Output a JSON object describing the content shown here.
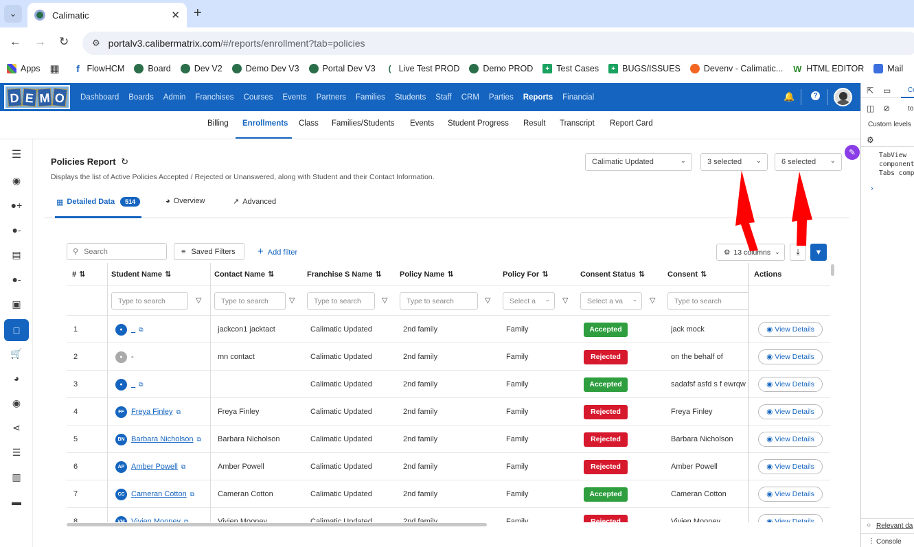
{
  "browser": {
    "tab_title": "Calimatic",
    "url_domain": "portalv3.calibermatrix.com",
    "url_path": "/#/reports/enrollment?tab=policies",
    "bookmarks": [
      "Apps",
      "FlowHCM",
      "Board",
      "Dev V2",
      "Demo Dev V3",
      "Portal Dev V3",
      "Live Test PROD",
      "Demo PROD",
      "Test Cases",
      "BUGS/ISSUES",
      "Devenv - Calimatic...",
      "HTML EDITOR",
      "Mail"
    ]
  },
  "app": {
    "logo_letters": [
      "D",
      "E",
      "M",
      "O"
    ],
    "main_menu": [
      "Dashboard",
      "Boards",
      "Admin",
      "Franchises",
      "Courses",
      "Events",
      "Partners",
      "Families",
      "Students",
      "Staff",
      "CRM",
      "Parties",
      "Reports",
      "Financial"
    ],
    "main_menu_active": "Reports",
    "sub_menu": [
      "Billing",
      "Enrollments",
      "Class",
      "Families/Students",
      "Events",
      "Student Progress",
      "Result",
      "Transcript",
      "Report Card"
    ],
    "sub_menu_active": "Enrollments"
  },
  "report": {
    "title": "Policies Report",
    "subtitle": "Displays the list of Active Policies Accepted / Rejected or Unanswered, along with Student and their Contact Information.",
    "franchise_select": "Calimatic Updated",
    "select2": "3 selected",
    "select3": "6 selected",
    "tabs": [
      "Detailed Data",
      "Overview",
      "Advanced"
    ],
    "detailed_count": "514",
    "search_placeholder": "Search",
    "saved_filters": "Saved Filters",
    "add_filter": "Add filter",
    "columns_button": "13 columns"
  },
  "table": {
    "headers": [
      "#",
      "Student Name",
      "Contact Name",
      "Franchise S Name",
      "Policy Name",
      "Policy For",
      "Consent Status",
      "Consent",
      "Actions"
    ],
    "filter_placeholders": {
      "type": "Type to search",
      "select_a": "Select a",
      "select_a_va": "Select a va"
    },
    "rows": [
      {
        "num": "1",
        "initials": "",
        "student": "_",
        "contact": "jackcon1 jacktact",
        "franchise": "Calimatic Updated",
        "policy": "2nd family",
        "for": "Family",
        "status": "Accepted",
        "consent": "jack mock",
        "action": "View Details"
      },
      {
        "num": "2",
        "initials": "",
        "student": "-",
        "contact": "mn contact",
        "franchise": "Calimatic Updated",
        "policy": "2nd family",
        "for": "Family",
        "status": "Rejected",
        "consent": "on the behalf of",
        "action": "View Details"
      },
      {
        "num": "3",
        "initials": "",
        "student": "_",
        "contact": "",
        "franchise": "Calimatic Updated",
        "policy": "2nd family",
        "for": "Family",
        "status": "Accepted",
        "consent": "sadafsf asfd s f ewrqw",
        "action": "View Details"
      },
      {
        "num": "4",
        "initials": "FF",
        "student": "Freya Finley",
        "contact": "Freya Finley",
        "franchise": "Calimatic Updated",
        "policy": "2nd family",
        "for": "Family",
        "status": "Rejected",
        "consent": "Freya Finley",
        "action": "View Details"
      },
      {
        "num": "5",
        "initials": "BN",
        "student": "Barbara Nicholson",
        "contact": "Barbara Nicholson",
        "franchise": "Calimatic Updated",
        "policy": "2nd family",
        "for": "Family",
        "status": "Rejected",
        "consent": "Barbara Nicholson",
        "action": "View Details"
      },
      {
        "num": "6",
        "initials": "AP",
        "student": "Amber Powell",
        "contact": "Amber Powell",
        "franchise": "Calimatic Updated",
        "policy": "2nd family",
        "for": "Family",
        "status": "Rejected",
        "consent": "Amber Powell",
        "action": "View Details"
      },
      {
        "num": "7",
        "initials": "CC",
        "student": "Cameran Cotton",
        "contact": "Cameran Cotton",
        "franchise": "Calimatic Updated",
        "policy": "2nd family",
        "for": "Family",
        "status": "Accepted",
        "consent": "Cameran Cotton",
        "action": "View Details"
      },
      {
        "num": "8",
        "initials": "VM",
        "student": "Vivien Mooney",
        "contact": "Vivien Mooney",
        "franchise": "Calimatic Updated",
        "policy": "2nd family",
        "for": "Family",
        "status": "Rejected",
        "consent": "Vivien Mooney",
        "action": "View Details"
      }
    ]
  },
  "devtools": {
    "tab_label": "Co",
    "filter_text": "to",
    "custom_levels": "Custom levels",
    "code_lines": [
      "TabView",
      "component",
      "Tabs comp"
    ],
    "relevant_link": "Relevant da",
    "console_label": "Console"
  },
  "colors": {
    "brand": "#1565c0",
    "accepted": "#2e9e3e",
    "rejected": "#d7192d",
    "annotation_arrow": "#ff0000"
  }
}
